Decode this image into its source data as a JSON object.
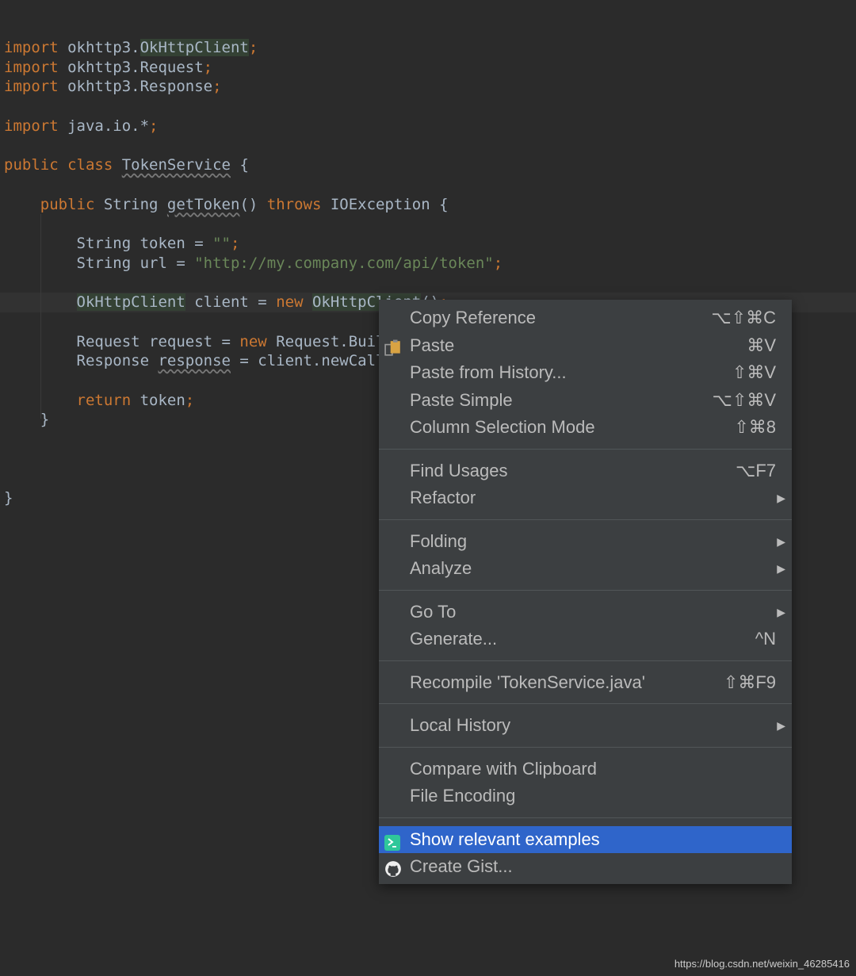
{
  "code_lines": [
    {
      "line": 0,
      "segments": [
        [
          "import ",
          "kw"
        ],
        [
          "okhttp3.",
          ""
        ],
        [
          "OkHttpClient",
          "hl"
        ],
        [
          ";",
          "kw"
        ]
      ]
    },
    {
      "line": 1,
      "segments": [
        [
          "import ",
          "kw"
        ],
        [
          "okhttp3.Request",
          ""
        ],
        [
          ";",
          "kw"
        ]
      ]
    },
    {
      "line": 2,
      "segments": [
        [
          "import ",
          "kw"
        ],
        [
          "okhttp3.Response",
          ""
        ],
        [
          ";",
          "kw"
        ]
      ]
    },
    {
      "line": 4,
      "segments": [
        [
          "import ",
          "kw"
        ],
        [
          "java.io.*",
          ""
        ],
        [
          ";",
          "kw"
        ]
      ]
    },
    {
      "line": 6,
      "segments": [
        [
          "public class ",
          "kw"
        ],
        [
          "TokenService",
          "wavy"
        ],
        [
          " {",
          ""
        ]
      ]
    },
    {
      "line": 8,
      "segments": [
        [
          "    ",
          ""
        ],
        [
          "public ",
          "kw"
        ],
        [
          "String ",
          ""
        ],
        [
          "getToken",
          "wavy"
        ],
        [
          "() ",
          ""
        ],
        [
          "throws ",
          "kw"
        ],
        [
          "IOException {",
          ""
        ]
      ]
    },
    {
      "line": 10,
      "segments": [
        [
          "        String token = ",
          ""
        ],
        [
          "\"\"",
          "str"
        ],
        [
          ";",
          "kw"
        ]
      ]
    },
    {
      "line": 11,
      "segments": [
        [
          "        String url = ",
          ""
        ],
        [
          "\"http://my.company.com/api/token\"",
          "str"
        ],
        [
          ";",
          "kw"
        ]
      ]
    },
    {
      "line": 13,
      "segments": [
        [
          "        ",
          ""
        ],
        [
          "OkHttpClient",
          "hl"
        ],
        [
          " client = ",
          ""
        ],
        [
          "new ",
          "kw"
        ],
        [
          "OkHttpClient",
          "hl"
        ],
        [
          "()",
          ""
        ],
        [
          ";",
          "kw"
        ]
      ]
    },
    {
      "line": 15,
      "segments": [
        [
          "        Request request = ",
          ""
        ],
        [
          "new ",
          "kw"
        ],
        [
          "Request.Builder().url(url).build()",
          ""
        ],
        [
          ";",
          "kw"
        ]
      ]
    },
    {
      "line": 16,
      "segments": [
        [
          "        Response ",
          ""
        ],
        [
          "response",
          "wavy"
        ],
        [
          " = client.newCall(request).execute()",
          ""
        ],
        [
          ";",
          "kw"
        ]
      ]
    },
    {
      "line": 18,
      "segments": [
        [
          "        ",
          ""
        ],
        [
          "return ",
          "kw"
        ],
        [
          "token",
          ""
        ],
        [
          ";",
          "kw"
        ]
      ]
    },
    {
      "line": 19,
      "segments": [
        [
          "    }",
          ""
        ]
      ]
    },
    {
      "line": 23,
      "segments": [
        [
          "}",
          ""
        ]
      ]
    }
  ],
  "context_menu": {
    "groups": [
      [
        {
          "label": "Copy Reference",
          "shortcut": "⌥⇧⌘C"
        },
        {
          "label": "Paste",
          "shortcut": "⌘V",
          "icon": "paste-icon"
        },
        {
          "label": "Paste from History...",
          "shortcut": "⇧⌘V"
        },
        {
          "label": "Paste Simple",
          "shortcut": "⌥⇧⌘V"
        },
        {
          "label": "Column Selection Mode",
          "shortcut": "⇧⌘8"
        }
      ],
      [
        {
          "label": "Find Usages",
          "shortcut": "⌥F7"
        },
        {
          "label": "Refactor",
          "submenu": true
        }
      ],
      [
        {
          "label": "Folding",
          "submenu": true
        },
        {
          "label": "Analyze",
          "submenu": true
        }
      ],
      [
        {
          "label": "Go To",
          "submenu": true
        },
        {
          "label": "Generate...",
          "shortcut": "^N"
        }
      ],
      [
        {
          "label": "Recompile 'TokenService.java'",
          "shortcut": "⇧⌘F9"
        }
      ],
      [
        {
          "label": "Local History",
          "submenu": true
        }
      ],
      [
        {
          "label": "Compare with Clipboard"
        },
        {
          "label": "File Encoding"
        }
      ],
      [
        {
          "label": "Show relevant examples",
          "icon": "terminal-icon",
          "selected": true
        },
        {
          "label": "Create Gist...",
          "icon": "github-icon"
        }
      ]
    ]
  },
  "colors": {
    "selection": "#2f65ca",
    "menu_bg": "#3c3f41",
    "editor_bg": "#2b2b2b",
    "keyword": "#cc7832",
    "string": "#6a8759"
  },
  "watermark": "https://blog.csdn.net/weixin_46285416"
}
